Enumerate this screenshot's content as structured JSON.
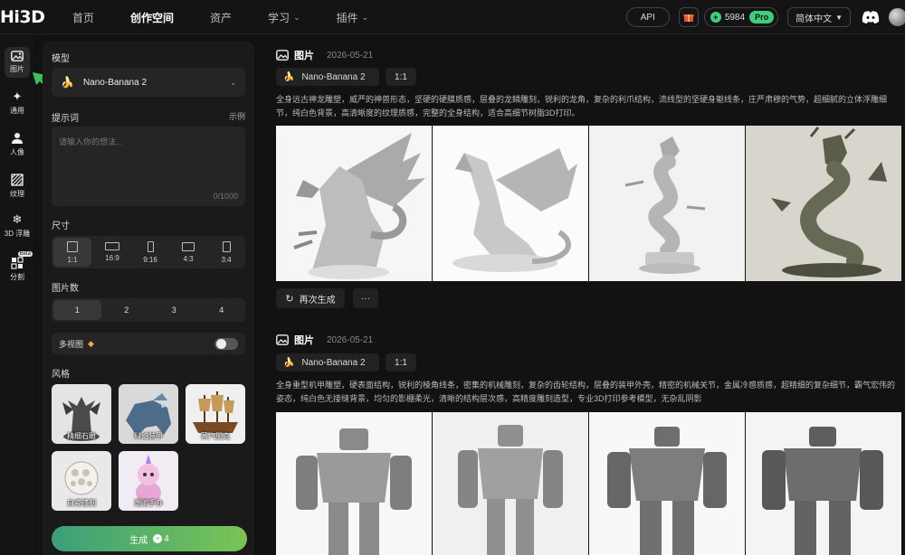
{
  "app": {
    "logo": "Hi3D"
  },
  "nav": {
    "items": [
      {
        "label": "首页",
        "active": false,
        "dropdown": false
      },
      {
        "label": "创作空间",
        "active": true,
        "dropdown": false
      },
      {
        "label": "资产",
        "active": false,
        "dropdown": false
      },
      {
        "label": "学习",
        "active": false,
        "dropdown": true
      },
      {
        "label": "插件",
        "active": false,
        "dropdown": true
      }
    ],
    "api_label": "API",
    "credits": "5984",
    "pro_label": "Pro",
    "language": "简体中文"
  },
  "rail": {
    "items": [
      {
        "label": "图片",
        "icon": "image-icon",
        "active": true
      },
      {
        "label": "通用",
        "icon": "sparkle-icon",
        "active": false
      },
      {
        "label": "人像",
        "icon": "people-icon",
        "active": false
      },
      {
        "label": "纹理",
        "icon": "texture-icon",
        "active": false
      },
      {
        "label": "3D 浮雕",
        "icon": "relief-icon",
        "active": false
      },
      {
        "label": "分割",
        "icon": "split-icon",
        "active": false,
        "badge": "Beta"
      }
    ]
  },
  "panel": {
    "model_label": "模型",
    "model_value": "Nano-Banana 2",
    "prompt_label": "提示词",
    "example_label": "示例",
    "prompt_placeholder": "请输入你的想法...",
    "prompt_counter": "0/1000",
    "size_label": "尺寸",
    "ratios": [
      {
        "label": "1:1",
        "active": true
      },
      {
        "label": "16:9",
        "active": false
      },
      {
        "label": "9:16",
        "active": false
      },
      {
        "label": "4:3",
        "active": false
      },
      {
        "label": "3:4",
        "active": false
      }
    ],
    "count_label": "图片数",
    "counts": [
      {
        "label": "1",
        "active": true
      },
      {
        "label": "2",
        "active": false
      },
      {
        "label": "3",
        "active": false
      },
      {
        "label": "4",
        "active": false
      }
    ],
    "multiview_label": "多视图",
    "multiview_on": false,
    "style_label": "风格",
    "styles": [
      "精细石雕",
      "科幻装甲",
      "蒸汽朋克",
      "白瓷镂刻",
      "潮流手办"
    ],
    "generate_label": "生成",
    "generate_cost": "4"
  },
  "feed": {
    "records": [
      {
        "type": "图片",
        "date": "2026-05-21",
        "model": "Nano-Banana 2",
        "ratio": "1:1",
        "prompt": "全身远古神龙雕塑，威严的神兽形态，坚硬的硬膜质感，层叠的龙鳞雕刻，锐利的龙角，复杂的利爪结构，流线型的坚硬身躯线条，庄严肃穆的气势，超细腻的立体浮雕细节，纯白色背景，高清晰度的纹理质感，完整的全身结构，适合高细节树脂3D打印。",
        "regenerate_label": "再次生成",
        "more_label": "···"
      },
      {
        "type": "图片",
        "date": "2026-05-21",
        "model": "Nano-Banana 2",
        "ratio": "1:1",
        "prompt": "全身重型机甲雕塑，硬表面结构，锐利的棱角线条，密集的机械雕刻，复杂的齿轮结构，层叠的装甲外壳，精密的机械关节，金属冷感质感，超精细的复杂细节，霸气宏伟的姿态，纯白色无接缝背景，均匀的影棚柔光，清晰的结构层次感，高精度雕刻造型，专业3D打印参考模型，无杂乱阴影"
      }
    ]
  }
}
